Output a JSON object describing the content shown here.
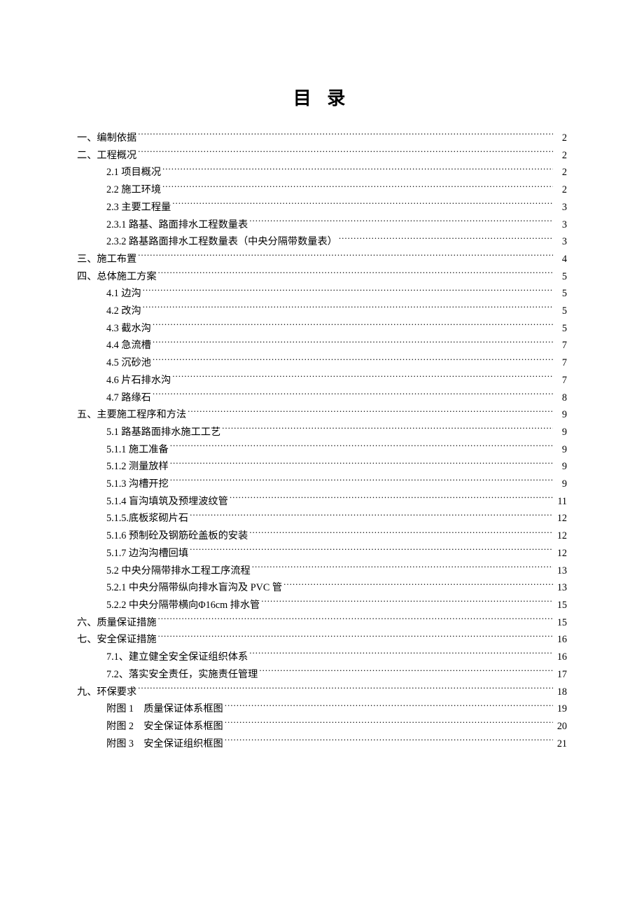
{
  "title": "目 录",
  "toc": [
    {
      "level": 0,
      "text": "一、编制依据",
      "page": "2"
    },
    {
      "level": 0,
      "text": "二、工程概况",
      "page": "2"
    },
    {
      "level": 1,
      "text": "2.1 项目概况",
      "page": "2"
    },
    {
      "level": 1,
      "text": "2.2 施工环境",
      "page": "2"
    },
    {
      "level": 1,
      "text": "2.3 主要工程量",
      "page": "3"
    },
    {
      "level": 1,
      "text": "2.3.1 路基、路面排水工程数量表",
      "page": "3"
    },
    {
      "level": 1,
      "text": "2.3.2 路基路面排水工程数量表（中央分隔带数量表）",
      "page": "3"
    },
    {
      "level": 0,
      "text": "三、施工布置",
      "page": "4"
    },
    {
      "level": 0,
      "text": "四、总体施工方案",
      "page": "5"
    },
    {
      "level": 1,
      "text": "4.1 边沟",
      "page": "5"
    },
    {
      "level": 1,
      "text": "4.2 改沟",
      "page": "5"
    },
    {
      "level": 1,
      "text": "4.3 截水沟",
      "page": "5"
    },
    {
      "level": 1,
      "text": "4.4 急流槽",
      "page": "7"
    },
    {
      "level": 1,
      "text": "4.5 沉砂池",
      "page": "7"
    },
    {
      "level": 1,
      "text": "4.6 片石排水沟",
      "page": "7"
    },
    {
      "level": 1,
      "text": "4.7 路缘石",
      "page": "8"
    },
    {
      "level": 0,
      "text": "五、主要施工程序和方法",
      "page": "9"
    },
    {
      "level": 1,
      "text": "5.1 路基路面排水施工工艺",
      "page": "9"
    },
    {
      "level": 1,
      "text": "5.1.1 施工准备",
      "page": "9"
    },
    {
      "level": 1,
      "text": "5.1.2 测量放样",
      "page": "9"
    },
    {
      "level": 1,
      "text": "5.1.3 沟槽开挖",
      "page": "9"
    },
    {
      "level": 1,
      "text": "5.1.4 盲沟填筑及预埋波纹管",
      "page": "11"
    },
    {
      "level": 1,
      "text": "5.1.5.底板浆砌片石",
      "page": "12"
    },
    {
      "level": 1,
      "text": "5.1.6 预制砼及钢筋砼盖板的安装",
      "page": "12"
    },
    {
      "level": 1,
      "text": "5.1.7 边沟沟槽回填",
      "page": "12"
    },
    {
      "level": 1,
      "text": "5.2 中央分隔带排水工程工序流程",
      "page": "13"
    },
    {
      "level": 1,
      "text": "5.2.1 中央分隔带纵向排水盲沟及 PVC 管",
      "page": "13"
    },
    {
      "level": 1,
      "text": "5.2.2 中央分隔带横向Φ16cm 排水管",
      "page": "15"
    },
    {
      "level": 0,
      "text": "六、质量保证措施",
      "page": "15"
    },
    {
      "level": 0,
      "text": "七、安全保证措施",
      "page": "16"
    },
    {
      "level": 1,
      "text": "7.1、建立健全安全保证组织体系",
      "page": "16"
    },
    {
      "level": 1,
      "text": "7.2、落实安全责任，实施责任管理",
      "page": "17"
    },
    {
      "level": 0,
      "text": "九、环保要求",
      "page": "18"
    },
    {
      "level": 1,
      "text": "附图 1　质量保证体系框图",
      "page": "19"
    },
    {
      "level": 1,
      "text": "附图 2　安全保证体系框图",
      "page": "20"
    },
    {
      "level": 1,
      "text": "附图 3　安全保证组织框图",
      "page": "21"
    }
  ]
}
